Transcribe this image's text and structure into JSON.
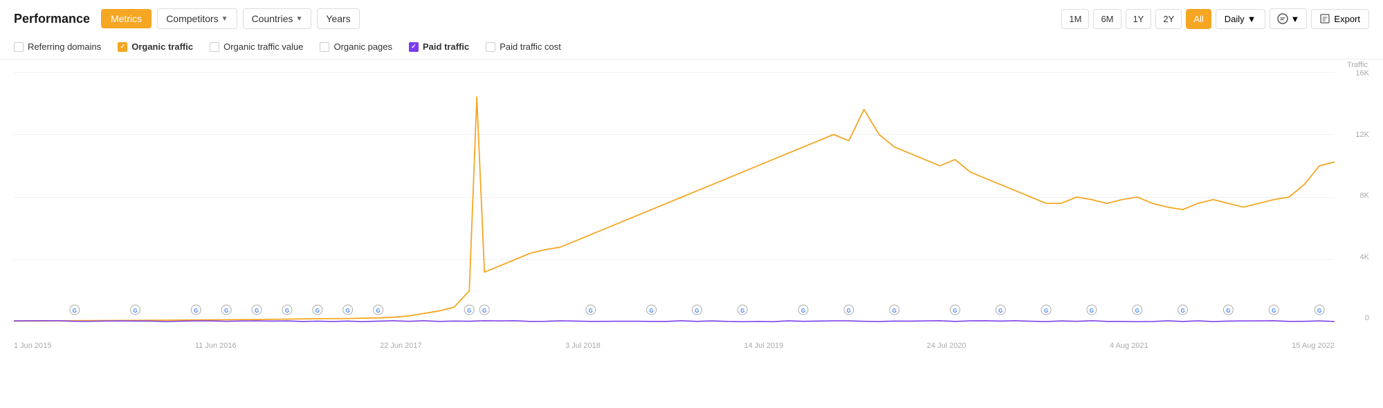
{
  "header": {
    "title": "Performance",
    "buttons": {
      "metrics": "Metrics",
      "competitors": "Competitors",
      "countries": "Countries",
      "years": "Years"
    },
    "time_ranges": [
      "1M",
      "6M",
      "1Y",
      "2Y",
      "All"
    ],
    "active_time_range": "All",
    "interval": "Daily",
    "export": "Export"
  },
  "metrics": [
    {
      "label": "Referring domains",
      "checked": false,
      "type": "none"
    },
    {
      "label": "Organic traffic",
      "checked": true,
      "type": "orange"
    },
    {
      "label": "Organic traffic value",
      "checked": false,
      "type": "none"
    },
    {
      "label": "Organic pages",
      "checked": false,
      "type": "none"
    },
    {
      "label": "Paid traffic",
      "checked": true,
      "type": "purple"
    },
    {
      "label": "Paid traffic cost",
      "checked": false,
      "type": "none"
    }
  ],
  "chart": {
    "y_axis_label": "Traffic",
    "y_labels": [
      "16K",
      "12K",
      "8K",
      "4K",
      "0"
    ],
    "x_labels": [
      "1 Jun 2015",
      "11 Jun 2016",
      "22 Jun 2017",
      "3 Jul 2018",
      "14 Jul 2019",
      "24 Jul 2020",
      "4 Aug 2021",
      "15 Aug 2022"
    ],
    "colors": {
      "orange_line": "#f5a623",
      "purple_line": "#7c3aed",
      "grid": "#f0f0f0"
    }
  }
}
